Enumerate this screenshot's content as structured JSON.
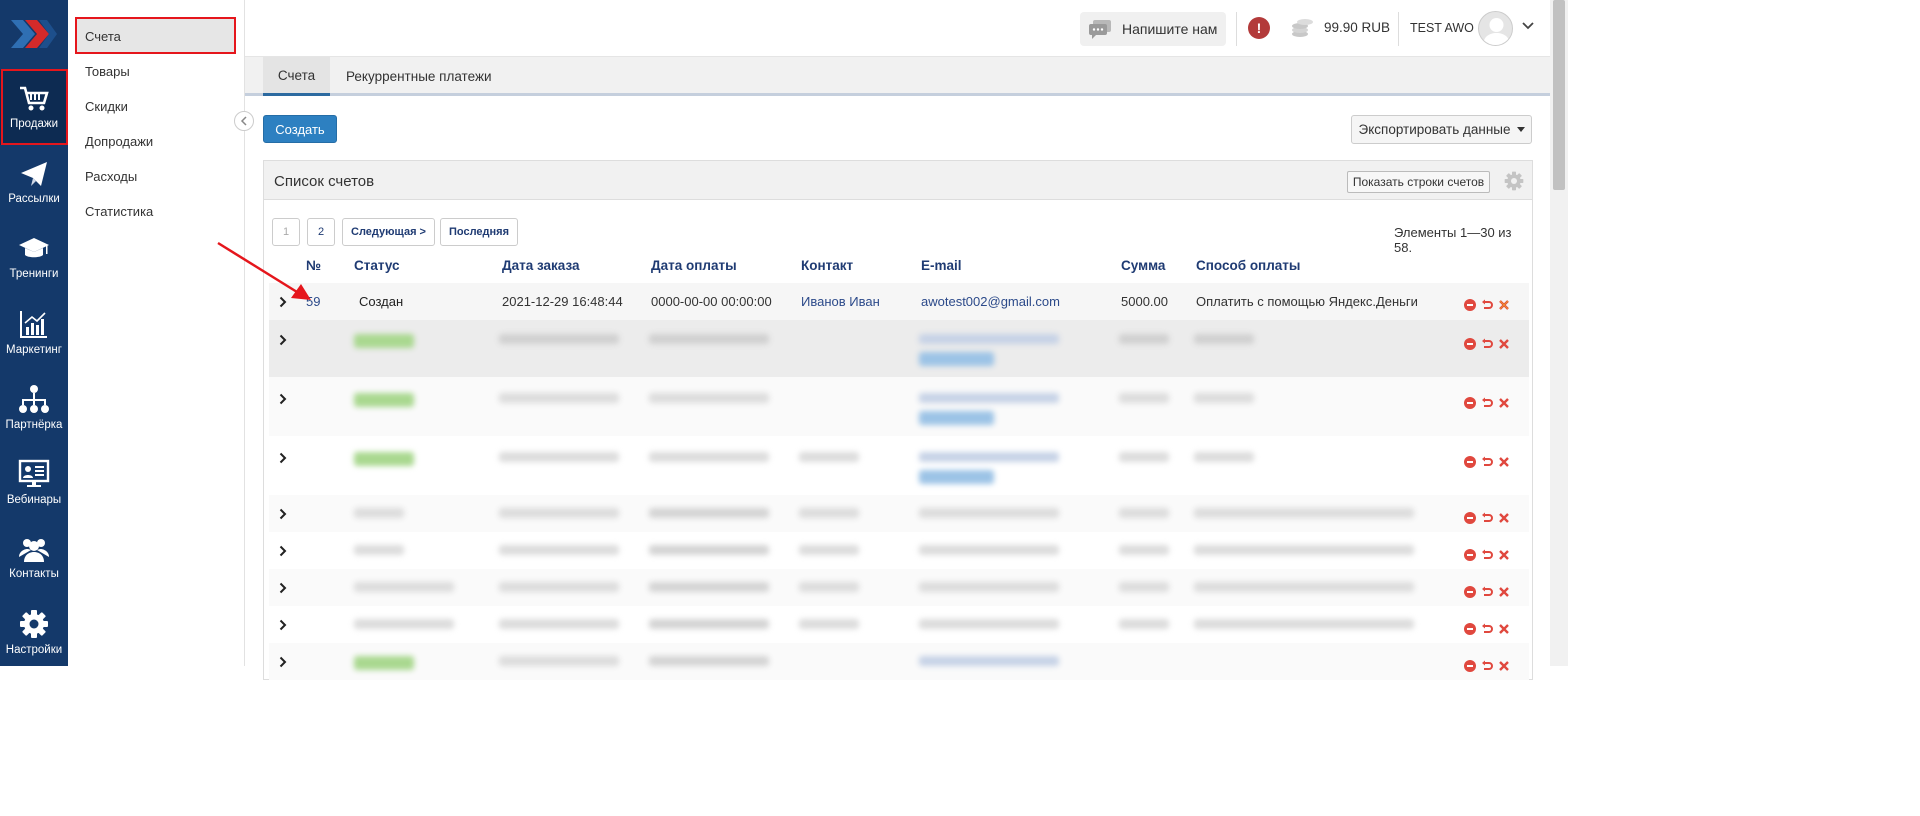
{
  "rail": {
    "items": [
      {
        "label": "Продажи",
        "icon": "cart-icon"
      },
      {
        "label": "Рассылки",
        "icon": "paper-plane-icon"
      },
      {
        "label": "Тренинги",
        "icon": "graduation-cap-icon"
      },
      {
        "label": "Маркетинг",
        "icon": "chart-icon"
      },
      {
        "label": "Партнёрка",
        "icon": "network-icon"
      },
      {
        "label": "Вебинары",
        "icon": "presentation-icon"
      },
      {
        "label": "Контакты",
        "icon": "users-icon"
      },
      {
        "label": "Настройки",
        "icon": "gear-icon"
      }
    ]
  },
  "submenu": {
    "items": [
      "Счета",
      "Товары",
      "Скидки",
      "Допродажи",
      "Расходы",
      "Статистика"
    ]
  },
  "header": {
    "write_us": "Напишите нам",
    "balance": "99.90 RUB",
    "username": "TEST AWO"
  },
  "tabs": [
    "Счета",
    "Рекуррентные платежи"
  ],
  "toolbar": {
    "create": "Создать",
    "export": "Экспортировать данные"
  },
  "panel": {
    "title": "Список счетов",
    "show_rows": "Показать строки счетов"
  },
  "pagination": {
    "pages": [
      "1",
      "2"
    ],
    "next": "Следующая >",
    "last": "Последняя",
    "summary": "Элементы 1—30 из 58."
  },
  "table": {
    "columns": [
      "№",
      "Статус",
      "Дата заказа",
      "Дата оплаты",
      "Контакт",
      "E-mail",
      "Сумма",
      "Способ оплаты"
    ],
    "first_row": {
      "number": "59",
      "status": "Создан",
      "order_date": "2021-12-29 16:48:44",
      "payment_date": "0000-00-00 00:00:00",
      "contact": "Иванов Иван",
      "email": "awotest002@gmail.com",
      "amount": "5000.00",
      "payment_method": "Оплатить с помощью Яндекс.Деньги"
    }
  },
  "colors": {
    "rail": "#14396a",
    "accent": "#2d80c1",
    "link": "#1f3b73",
    "highlight": "#e5161c"
  }
}
